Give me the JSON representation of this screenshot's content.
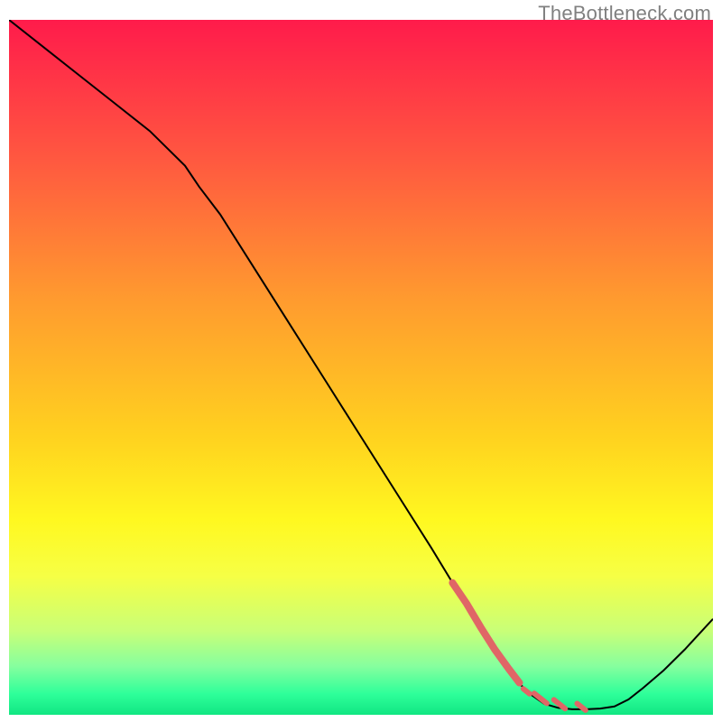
{
  "watermark": "TheBottleneck.com",
  "chart_data": {
    "type": "line",
    "title": "",
    "xlabel": "",
    "ylabel": "",
    "xlim": [
      0,
      100
    ],
    "ylim": [
      0,
      100
    ],
    "grid": false,
    "legend": false,
    "background_gradient_stops": [
      {
        "offset": 0.0,
        "color": "#ff1b4b"
      },
      {
        "offset": 0.2,
        "color": "#ff5840"
      },
      {
        "offset": 0.4,
        "color": "#ff9a2f"
      },
      {
        "offset": 0.6,
        "color": "#ffd21f"
      },
      {
        "offset": 0.72,
        "color": "#fff820"
      },
      {
        "offset": 0.8,
        "color": "#f6ff45"
      },
      {
        "offset": 0.88,
        "color": "#c8ff78"
      },
      {
        "offset": 0.93,
        "color": "#86ff9e"
      },
      {
        "offset": 0.97,
        "color": "#2eff9a"
      },
      {
        "offset": 1.0,
        "color": "#11e682"
      }
    ],
    "series": [
      {
        "name": "bottleneck-curve",
        "color": "#000000",
        "stroke_width": 2,
        "x": [
          0,
          5,
          10,
          15,
          20,
          25,
          27,
          30,
          35,
          40,
          45,
          50,
          55,
          60,
          63,
          65,
          68,
          70,
          72,
          74,
          76,
          78,
          80,
          82,
          84,
          86,
          88,
          90,
          93,
          96,
          100
        ],
        "y": [
          100,
          96,
          92,
          88,
          84,
          79,
          76,
          72,
          64,
          56,
          48,
          40,
          32,
          24,
          19,
          16,
          11,
          8,
          5,
          3,
          1.6,
          1.0,
          0.8,
          0.8,
          0.9,
          1.2,
          2.2,
          3.8,
          6.4,
          9.4,
          13.8
        ]
      },
      {
        "name": "highlight-dip",
        "color": "#e06666",
        "stroke_width_main": 8,
        "x_main": [
          63,
          65,
          67,
          69,
          71,
          72.5
        ],
        "y_main": [
          19,
          16,
          12.6,
          9.4,
          6.6,
          4.6
        ],
        "dots_stroke_width": 6,
        "dots": [
          {
            "x": 73.5,
            "y": 3.2
          },
          {
            "x": 75.5,
            "y": 2.0,
            "len": 1.8
          },
          {
            "x": 78.2,
            "y": 1.2,
            "len": 1.6
          },
          {
            "x": 81.3,
            "y": 0.9,
            "len": 1.2
          }
        ]
      }
    ]
  }
}
